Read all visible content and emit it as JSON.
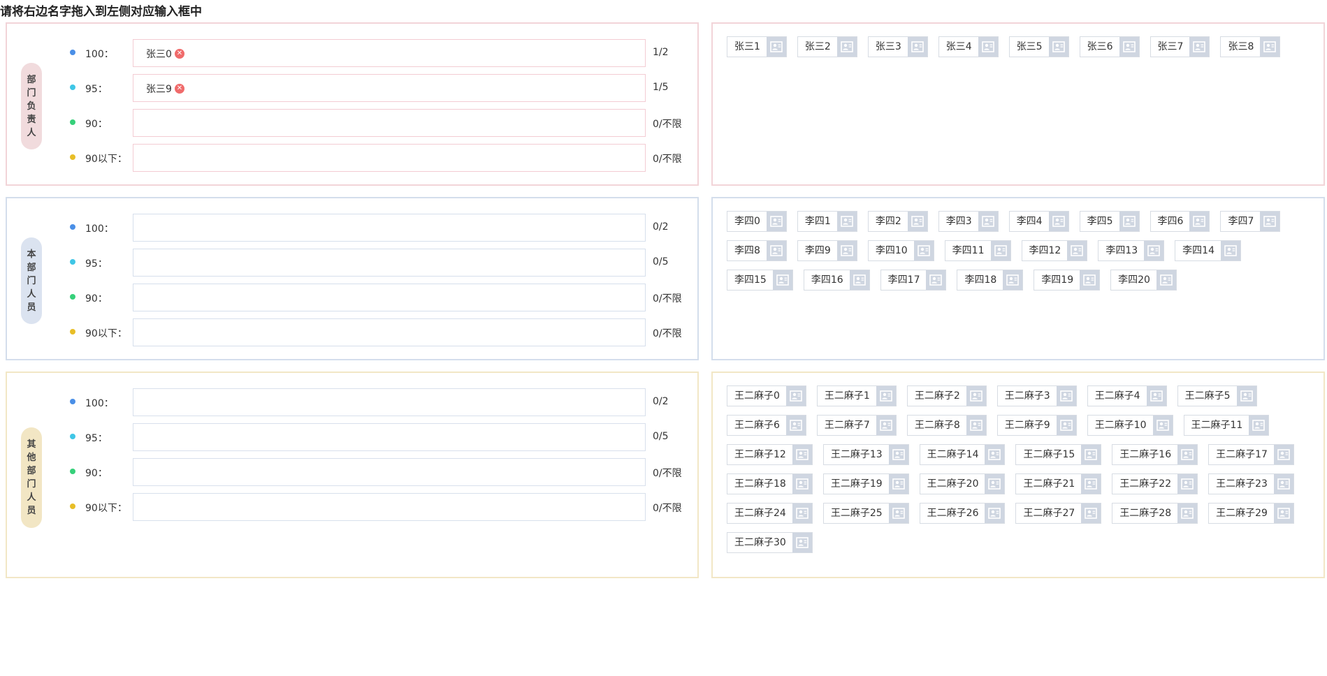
{
  "page": {
    "title": "请将右边名字拖入到左侧对应输入框中"
  },
  "sections": [
    {
      "label": "部门负责人",
      "theme": {
        "border": "#f2d4d8",
        "label_bg": "#f1dbdd",
        "input_border": "#f3ccd3"
      },
      "rows": [
        {
          "label": "100：",
          "dot": "#4a8fe7",
          "count": "1/2",
          "items": [
            "张三0"
          ]
        },
        {
          "label": "95：",
          "dot": "#3fc6e6",
          "count": "1/5",
          "items": [
            "张三9"
          ]
        },
        {
          "label": "90：",
          "dot": "#36d07a",
          "count": "0/不限",
          "items": []
        },
        {
          "label": "90以下：",
          "dot": "#e8be27",
          "count": "0/不限",
          "items": []
        }
      ],
      "pool": [
        "张三1",
        "张三2",
        "张三3",
        "张三4",
        "张三5",
        "张三6",
        "张三7",
        "张三8"
      ]
    },
    {
      "label": "本部门人员",
      "theme": {
        "border": "#d4deec",
        "label_bg": "#dbe3f0",
        "input_border": "#d6dfec"
      },
      "rows": [
        {
          "label": "100：",
          "dot": "#4a8fe7",
          "count": "0/2",
          "items": []
        },
        {
          "label": "95：",
          "dot": "#3fc6e6",
          "count": "0/5",
          "items": []
        },
        {
          "label": "90：",
          "dot": "#36d07a",
          "count": "0/不限",
          "items": []
        },
        {
          "label": "90以下：",
          "dot": "#e8be27",
          "count": "0/不限",
          "items": []
        }
      ],
      "pool": [
        "李四0",
        "李四1",
        "李四2",
        "李四3",
        "李四4",
        "李四5",
        "李四6",
        "李四7",
        "李四8",
        "李四9",
        "李四10",
        "李四11",
        "李四12",
        "李四13",
        "李四14",
        "李四15",
        "李四16",
        "李四17",
        "李四18",
        "李四19",
        "李四20"
      ]
    },
    {
      "label": "其他部门人员",
      "theme": {
        "border": "#f2e7c6",
        "label_bg": "#f2e6c4",
        "input_border": "#d8e0ec"
      },
      "rows": [
        {
          "label": "100：",
          "dot": "#4a8fe7",
          "count": "0/2",
          "items": []
        },
        {
          "label": "95：",
          "dot": "#3fc6e6",
          "count": "0/5",
          "items": []
        },
        {
          "label": "90：",
          "dot": "#36d07a",
          "count": "0/不限",
          "items": []
        },
        {
          "label": "90以下：",
          "dot": "#e8be27",
          "count": "0/不限",
          "items": []
        }
      ],
      "pool": [
        "王二麻子0",
        "王二麻子1",
        "王二麻子2",
        "王二麻子3",
        "王二麻子4",
        "王二麻子5",
        "王二麻子6",
        "王二麻子7",
        "王二麻子8",
        "王二麻子9",
        "王二麻子10",
        "王二麻子11",
        "王二麻子12",
        "王二麻子13",
        "王二麻子14",
        "王二麻子15",
        "王二麻子16",
        "王二麻子17",
        "王二麻子18",
        "王二麻子19",
        "王二麻子20",
        "王二麻子21",
        "王二麻子22",
        "王二麻子23",
        "王二麻子24",
        "王二麻子25",
        "王二麻子26",
        "王二麻子27",
        "王二麻子28",
        "王二麻子29",
        "王二麻子30"
      ]
    }
  ],
  "icons": {
    "chip": "id-card-icon",
    "remove": "close-circle-icon"
  }
}
